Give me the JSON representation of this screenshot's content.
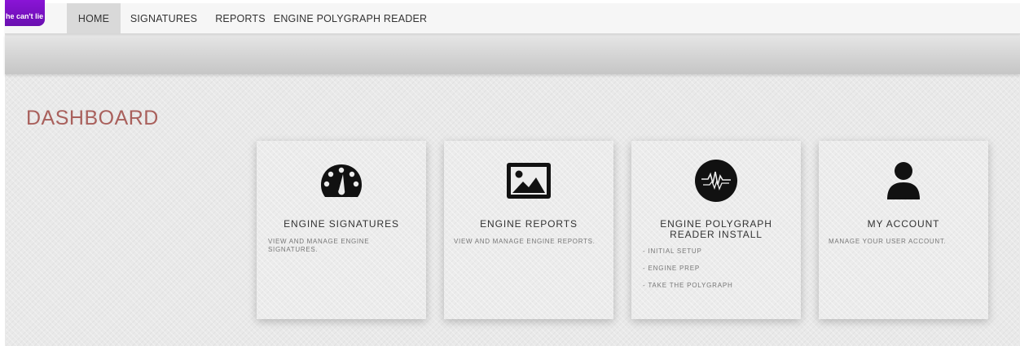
{
  "logo": {
    "text": "he can't lie"
  },
  "nav": {
    "items": [
      {
        "label": "HOME",
        "active": true
      },
      {
        "label": "SIGNATURES",
        "active": false
      },
      {
        "label": "REPORTS",
        "active": false
      },
      {
        "label": "ENGINE POLYGRAPH READER",
        "active": false
      }
    ]
  },
  "page": {
    "title": "DASHBOARD"
  },
  "cards": [
    {
      "icon": "speedometer-icon",
      "title": "ENGINE SIGNATURES",
      "description": "VIEW AND MANAGE ENGINE SIGNATURES."
    },
    {
      "icon": "image-icon",
      "title": "ENGINE REPORTS",
      "description": "VIEW AND MANAGE ENGINE REPORTS."
    },
    {
      "icon": "waveform-icon",
      "title_line1": "ENGINE POLYGRAPH",
      "title_line2": "READER INSTALL",
      "steps": [
        "- INITIAL SETUP",
        "- ENGINE PREP",
        "- TAKE THE POLYGRAPH"
      ]
    },
    {
      "icon": "user-icon",
      "title": "MY ACCOUNT",
      "description": "MANAGE YOUR USER ACCOUNT."
    }
  ],
  "colors": {
    "accent_title": "#a9605c",
    "logo_purple": "#7a12c4",
    "nav_active_bg": "#d9d9d9"
  }
}
